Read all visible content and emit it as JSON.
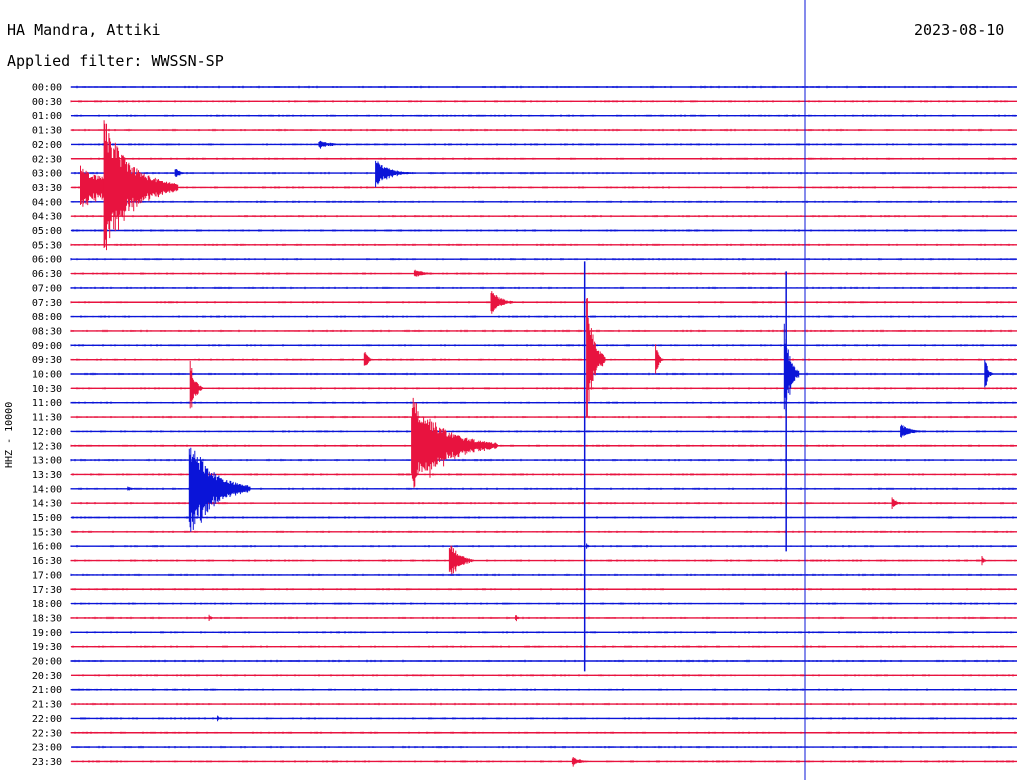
{
  "header": {
    "station": "HA Mandra, Attiki",
    "date": "2023-08-10",
    "filter": "Applied filter: WWSSN-SP",
    "channel_label": "HHZ - 10000"
  },
  "colors": {
    "blue": "#0a14d8",
    "red": "#e8133f",
    "marker": "#0a14d8"
  },
  "chart_data": {
    "type": "line",
    "title": "HA Mandra, Attiki",
    "subtitle": "Applied filter: WWSSN-SP",
    "ylabel": "HHZ - 10000",
    "rows": [
      "00:00",
      "00:30",
      "01:00",
      "01:30",
      "02:00",
      "02:30",
      "03:00",
      "03:30",
      "04:00",
      "04:30",
      "05:00",
      "05:30",
      "06:00",
      "06:30",
      "07:00",
      "07:30",
      "08:00",
      "08:30",
      "09:00",
      "09:30",
      "10:00",
      "10:30",
      "11:00",
      "11:30",
      "12:00",
      "12:30",
      "13:00",
      "13:30",
      "14:00",
      "14:30",
      "15:00",
      "15:30",
      "16:00",
      "16:30",
      "17:00",
      "17:30",
      "18:00",
      "18:30",
      "19:00",
      "19:30",
      "20:00",
      "20:30",
      "21:00",
      "21:30",
      "22:00",
      "22:30",
      "23:00",
      "23:30"
    ],
    "row_colors": "alternating blue/red starting blue",
    "x_minutes_per_row": 30,
    "current_time_marker_fraction": 0.776,
    "events": [
      {
        "row": 6,
        "t": 0.11,
        "amp": 6,
        "dur": 0.01
      },
      {
        "row": 4,
        "t": 0.262,
        "amp": 4,
        "dur": 0.03
      },
      {
        "row": 7,
        "t": 0.01,
        "amp": 22,
        "dur": 0.07
      },
      {
        "row": 7,
        "t": 0.035,
        "amp": 70,
        "dur": 0.06
      },
      {
        "row": 6,
        "t": 0.322,
        "amp": 14,
        "dur": 0.03
      },
      {
        "row": 13,
        "t": 0.363,
        "amp": 5,
        "dur": 0.02
      },
      {
        "row": 15,
        "t": 0.444,
        "amp": 14,
        "dur": 0.02
      },
      {
        "row": 19,
        "t": 0.31,
        "amp": 10,
        "dur": 0.008
      },
      {
        "row": 19,
        "t": 0.545,
        "amp": 70,
        "dur": 0.015
      },
      {
        "row": 19,
        "t": 0.618,
        "amp": 20,
        "dur": 0.006
      },
      {
        "row": 21,
        "t": 0.126,
        "amp": 30,
        "dur": 0.01
      },
      {
        "row": 20,
        "t": 0.754,
        "amp": 55,
        "dur": 0.012
      },
      {
        "row": 20,
        "t": 0.966,
        "amp": 22,
        "dur": 0.006
      },
      {
        "row": 24,
        "t": 0.877,
        "amp": 8,
        "dur": 0.02
      },
      {
        "row": 25,
        "t": 0.36,
        "amp": 52,
        "dur": 0.07
      },
      {
        "row": 28,
        "t": 0.125,
        "amp": 55,
        "dur": 0.05
      },
      {
        "row": 28,
        "t": 0.06,
        "amp": 3,
        "dur": 0.01
      },
      {
        "row": 29,
        "t": 0.868,
        "amp": 7,
        "dur": 0.01
      },
      {
        "row": 33,
        "t": 0.4,
        "amp": 22,
        "dur": 0.02
      },
      {
        "row": 33,
        "t": 0.963,
        "amp": 5,
        "dur": 0.005
      },
      {
        "row": 37,
        "t": 0.146,
        "amp": 4,
        "dur": 0.005
      },
      {
        "row": 37,
        "t": 0.47,
        "amp": 4,
        "dur": 0.005
      },
      {
        "row": 47,
        "t": 0.53,
        "amp": 5,
        "dur": 0.02
      },
      {
        "row": 32,
        "t": 0.545,
        "amp": 3,
        "dur": 0.006
      },
      {
        "row": 44,
        "t": 0.155,
        "amp": 3,
        "dur": 0.005
      }
    ],
    "spikes": [
      {
        "row": 24,
        "t": 0.543,
        "up": 170,
        "down": 240
      },
      {
        "row": 24,
        "t": 0.756,
        "up": 160,
        "down": 120
      }
    ]
  }
}
